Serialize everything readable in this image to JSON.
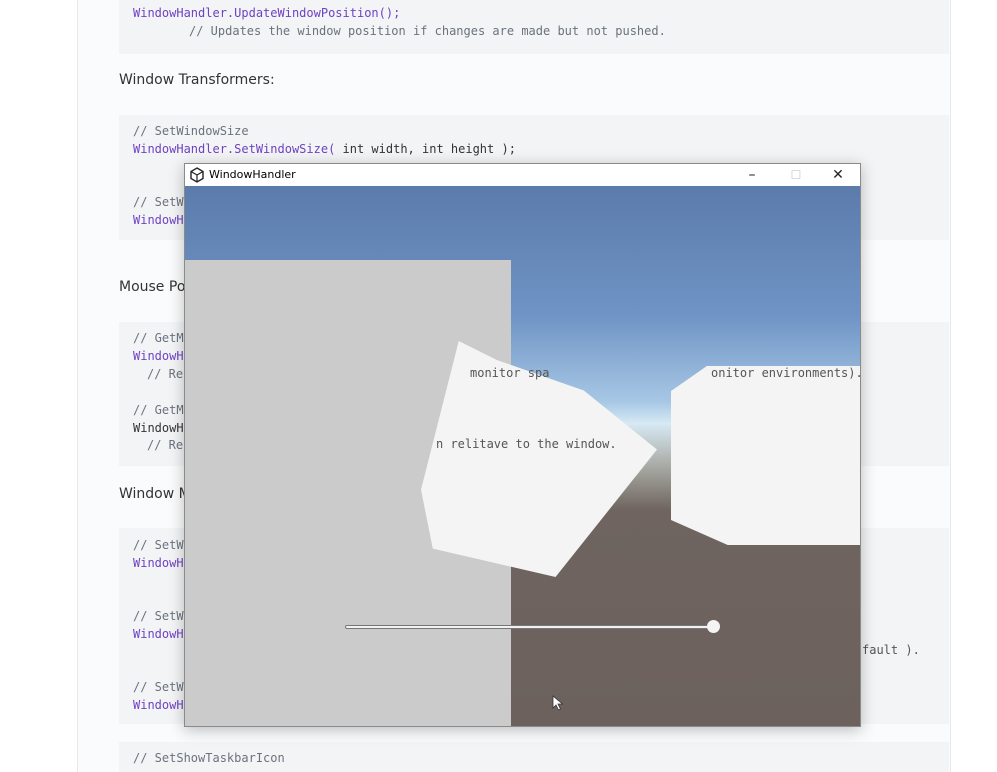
{
  "doc": {
    "top_block": {
      "line1": "WindowHandler.UpdateWindowPosition();",
      "line2": "// Updates the window position if changes are made but not pushed."
    },
    "headings": {
      "transformers": "Window Transformers:",
      "mouse": "Mouse Po",
      "window": "Window M"
    },
    "transformers_block": {
      "line1": "// SetWindowSize",
      "line2_fn": "WindowHandler.SetWindowSize(",
      "line2_args": " int width, int height );",
      "line3": "// SetW",
      "line4": "WindowH"
    },
    "mouse_block": {
      "line1": "// GetM",
      "line2": "WindowH",
      "line3": "// Re",
      "line4": "// GetM",
      "line5": "WindowH",
      "line6": "// Re"
    },
    "window_block": {
      "line1": "// SetW",
      "line2": "WindowH",
      "line3": "// SetW",
      "line4": "WindowH",
      "line5": "// SetW",
      "line6": "WindowH"
    },
    "bottom_line": "// SetShowTaskbarIcon",
    "stray": {
      "fault": "fault ).",
      "monitor_left": "monitor spa",
      "monitor_right": "onitor environments).",
      "relitave": "n relitave to the window."
    }
  },
  "window": {
    "title": "WindowHandler",
    "icon": "unity-logo-icon",
    "minimize": "–",
    "maximize": "☐",
    "close": "✕"
  },
  "slider": {
    "value_fraction": 0.97
  },
  "colors": {
    "sky_top": "#5b7bab",
    "horizon": "#d7e9f4",
    "ground": "#6c615d",
    "panel": "#cbcbcb",
    "code_fn": "#6f42c1"
  }
}
